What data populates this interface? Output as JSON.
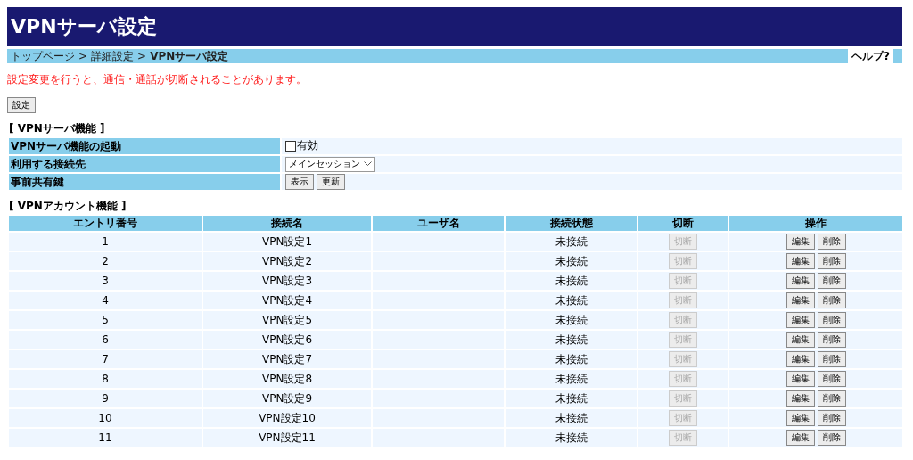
{
  "header": {
    "title": "VPNサーバ設定"
  },
  "breadcrumb": {
    "items": [
      {
        "label": "トップページ",
        "current": false
      },
      {
        "label": "詳細設定",
        "current": false
      },
      {
        "label": "VPNサーバ設定",
        "current": true
      }
    ],
    "separator": ">",
    "help": "ヘルプ?"
  },
  "warning": "設定変更を行うと、通信・通話が切断されることがあります。",
  "apply_button": "設定",
  "server_section": {
    "title": "[ VPNサーバ機能 ]",
    "rows": [
      {
        "kind": "checkbox",
        "label": "VPNサーバ機能の起動",
        "option": "有効",
        "checked": false
      },
      {
        "kind": "select",
        "label": "利用する接続先",
        "value": "メインセッション"
      },
      {
        "kind": "buttons",
        "label": "事前共有鍵",
        "buttons": [
          "表示",
          "更新"
        ]
      }
    ]
  },
  "account_section": {
    "title": "[ VPNアカウント機能 ]",
    "columns": [
      "エントリ番号",
      "接続名",
      "ユーザ名",
      "接続状態",
      "切断",
      "操作"
    ],
    "rows": [
      {
        "entry": "1",
        "name": "VPN設定1",
        "user": "",
        "status": "未接続",
        "disconnect": "切断",
        "disconnect_disabled": true,
        "actions": [
          "編集",
          "削除"
        ]
      },
      {
        "entry": "2",
        "name": "VPN設定2",
        "user": "",
        "status": "未接続",
        "disconnect": "切断",
        "disconnect_disabled": true,
        "actions": [
          "編集",
          "削除"
        ]
      },
      {
        "entry": "3",
        "name": "VPN設定3",
        "user": "",
        "status": "未接続",
        "disconnect": "切断",
        "disconnect_disabled": true,
        "actions": [
          "編集",
          "削除"
        ]
      },
      {
        "entry": "4",
        "name": "VPN設定4",
        "user": "",
        "status": "未接続",
        "disconnect": "切断",
        "disconnect_disabled": true,
        "actions": [
          "編集",
          "削除"
        ]
      },
      {
        "entry": "5",
        "name": "VPN設定5",
        "user": "",
        "status": "未接続",
        "disconnect": "切断",
        "disconnect_disabled": true,
        "actions": [
          "編集",
          "削除"
        ]
      },
      {
        "entry": "6",
        "name": "VPN設定6",
        "user": "",
        "status": "未接続",
        "disconnect": "切断",
        "disconnect_disabled": true,
        "actions": [
          "編集",
          "削除"
        ]
      },
      {
        "entry": "7",
        "name": "VPN設定7",
        "user": "",
        "status": "未接続",
        "disconnect": "切断",
        "disconnect_disabled": true,
        "actions": [
          "編集",
          "削除"
        ]
      },
      {
        "entry": "8",
        "name": "VPN設定8",
        "user": "",
        "status": "未接続",
        "disconnect": "切断",
        "disconnect_disabled": true,
        "actions": [
          "編集",
          "削除"
        ]
      },
      {
        "entry": "9",
        "name": "VPN設定9",
        "user": "",
        "status": "未接続",
        "disconnect": "切断",
        "disconnect_disabled": true,
        "actions": [
          "編集",
          "削除"
        ]
      },
      {
        "entry": "10",
        "name": "VPN設定10",
        "user": "",
        "status": "未接続",
        "disconnect": "切断",
        "disconnect_disabled": true,
        "actions": [
          "編集",
          "削除"
        ]
      },
      {
        "entry": "11",
        "name": "VPN設定11",
        "user": "",
        "status": "未接続",
        "disconnect": "切断",
        "disconnect_disabled": true,
        "actions": [
          "編集",
          "削除"
        ]
      }
    ]
  }
}
